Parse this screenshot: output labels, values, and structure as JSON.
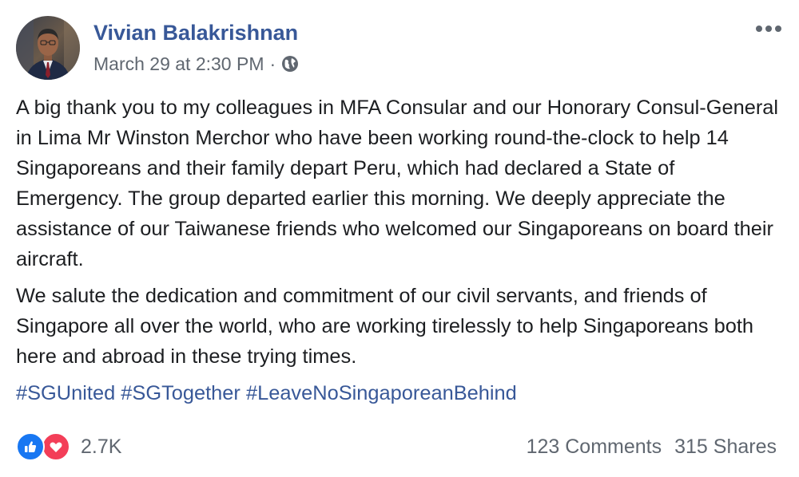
{
  "post": {
    "author": {
      "name": "Vivian Balakrishnan",
      "avatar_icon": "profile-photo"
    },
    "timestamp": "March 29 at 2:30 PM",
    "separator": "·",
    "privacy_icon": "globe-icon",
    "more_icon": "more-options-icon",
    "paragraphs": [
      "A big thank you to my colleagues in MFA Consular and our Honorary Consul-General in Lima Mr Winston Merchor who have been working round-the-clock to help 14 Singaporeans and their family depart Peru, which had declared a State of Emergency. The group departed earlier this morning. We deeply appreciate the assistance of our Taiwanese friends who welcomed our Singaporeans on board their aircraft.",
      "We salute the dedication and commitment of our civil servants, and friends of Singapore all over the world, who are working tirelessly to help Singaporeans both here and abroad in these trying times."
    ],
    "hashtags": [
      "#SGUnited",
      "#SGTogether",
      "#LeaveNoSingaporeanBehind"
    ]
  },
  "footer": {
    "reactions": {
      "icons": [
        "like-icon",
        "love-icon"
      ],
      "count": "2.7K"
    },
    "comments": "123 Comments",
    "shares": "315 Shares"
  },
  "colors": {
    "link": "#385898",
    "text": "#1c1e21",
    "secondary": "#606770",
    "like": "#1877f2",
    "love": "#f33e58"
  }
}
